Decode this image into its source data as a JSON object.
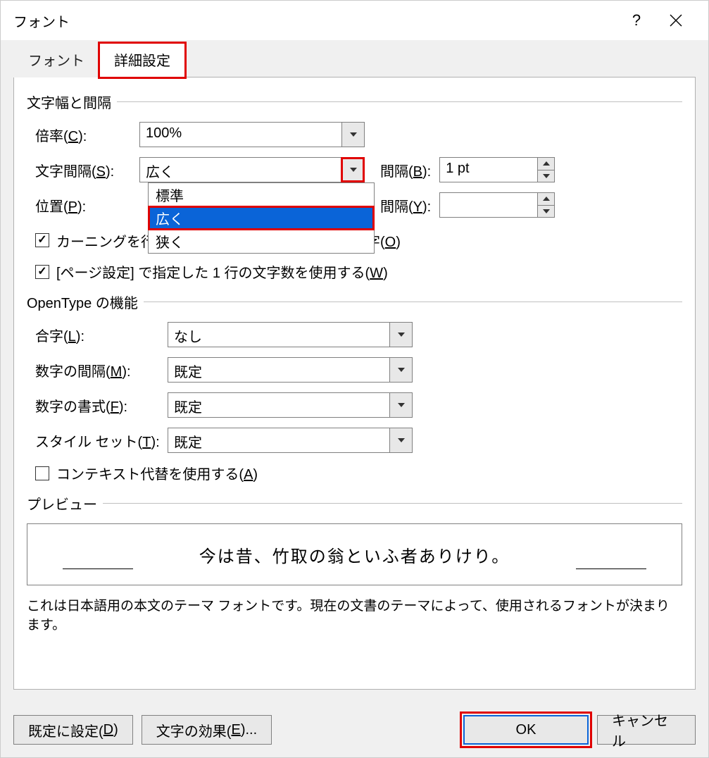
{
  "titlebar": {
    "title": "フォント"
  },
  "tabs": {
    "font": "フォント",
    "advanced": "詳細設定"
  },
  "group1": {
    "title": "文字幅と間隔",
    "scale_label_pre": "倍率(",
    "scale_label_key": "C",
    "scale_label_post": "):",
    "scale_value": "100%",
    "spacing_label_pre": "文字間隔(",
    "spacing_label_key": "S",
    "spacing_label_post": "):",
    "spacing_value": "広く",
    "spacing_opt1": "標準",
    "spacing_opt2": "広く",
    "spacing_opt3": "狭く",
    "by1_label_pre": "間隔(",
    "by1_label_key": "B",
    "by1_label_post": "):",
    "by1_value": "1 pt",
    "pos_label_pre": "位置(",
    "pos_label_key": "P",
    "pos_label_post": "):",
    "pos_value": "",
    "by2_label_pre": "間隔(",
    "by2_label_key": "Y",
    "by2_label_post": "):",
    "by2_value": "",
    "kern_cb_pre": "カーニングを行",
    "kern_suffix_pre": "ト以上の文字(",
    "kern_suffix_key": "O",
    "kern_suffix_post": ")",
    "grid_cb_pre": "[ページ設定] で指定した 1 行の文字数を使用する(",
    "grid_cb_key": "W",
    "grid_cb_post": ")"
  },
  "group2": {
    "title": "OpenType の機能",
    "lig_label_pre": "合字(",
    "lig_label_key": "L",
    "lig_label_post": "):",
    "lig_value": "なし",
    "nsp_label_pre": "数字の間隔(",
    "nsp_label_key": "M",
    "nsp_label_post": "):",
    "nsp_value": "既定",
    "nfm_label_pre": "数字の書式(",
    "nfm_label_key": "F",
    "nfm_label_post": "):",
    "nfm_value": "既定",
    "sty_label_pre": "スタイル セット(",
    "sty_label_key": "T",
    "sty_label_post": "):",
    "sty_value": "既定",
    "ctx_cb_pre": "コンテキスト代替を使用する(",
    "ctx_cb_key": "A",
    "ctx_cb_post": ")"
  },
  "preview": {
    "title": "プレビュー",
    "text": "今は昔、竹取の翁といふ者ありけり。",
    "desc": "これは日本語用の本文のテーマ フォントです。現在の文書のテーマによって、使用されるフォントが決まります。"
  },
  "footer": {
    "default_pre": "既定に設定(",
    "default_key": "D",
    "default_post": ")",
    "effects_pre": "文字の効果(",
    "effects_key": "E",
    "effects_post": ")...",
    "ok": "OK",
    "cancel": "キャンセル"
  }
}
